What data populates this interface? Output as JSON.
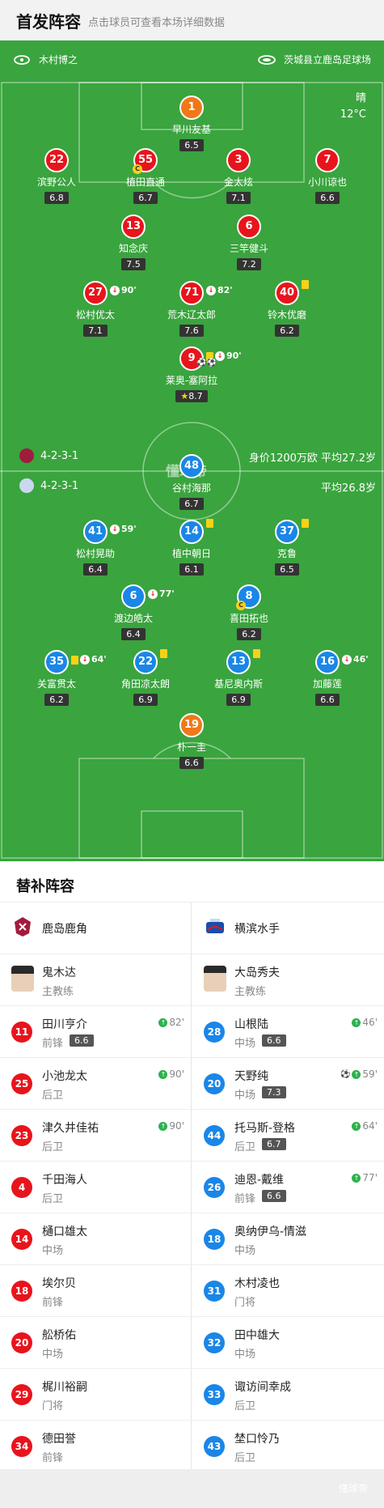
{
  "header": {
    "title": "首发阵容",
    "subtitle": "点击球员可查看本场详细数据"
  },
  "match": {
    "referee": "木村博之",
    "venue": "茨城县立鹿岛足球场",
    "weather": "晴",
    "temperature": "12°C",
    "watermark": "懂球帝"
  },
  "home": {
    "formation": "4-2-3-1",
    "info": "身价1200万欧 平均27.2岁"
  },
  "away": {
    "formation": "4-2-3-1",
    "info": "平均26.8岁"
  },
  "home_players": [
    {
      "num": "1",
      "name": "早川友基",
      "rating": "6.5",
      "color": "orange"
    },
    {
      "num": "22",
      "name": "滨野公人",
      "rating": "6.8",
      "color": "red"
    },
    {
      "num": "55",
      "name": "植田直通",
      "rating": "6.7",
      "color": "red",
      "captain": true
    },
    {
      "num": "3",
      "name": "金太炫",
      "rating": "7.1",
      "color": "red"
    },
    {
      "num": "7",
      "name": "小川谅也",
      "rating": "6.6",
      "color": "red"
    },
    {
      "num": "13",
      "name": "知念庆",
      "rating": "7.5",
      "color": "red"
    },
    {
      "num": "6",
      "name": "三竿健斗",
      "rating": "7.2",
      "color": "red"
    },
    {
      "num": "27",
      "name": "松村优太",
      "rating": "7.1",
      "color": "red",
      "sub": "90'"
    },
    {
      "num": "71",
      "name": "荒木辽太郎",
      "rating": "7.6",
      "color": "red",
      "sub": "82'"
    },
    {
      "num": "40",
      "name": "铃木优磨",
      "rating": "6.2",
      "color": "red",
      "card": true
    },
    {
      "num": "9",
      "name": "莱奥-塞阿拉",
      "rating": "8.7",
      "color": "red",
      "card": true,
      "sub": "90'",
      "goals": "⚽⚽",
      "star": true
    }
  ],
  "away_players": [
    {
      "num": "48",
      "name": "谷村海那",
      "rating": "6.7",
      "color": "blue"
    },
    {
      "num": "41",
      "name": "松村晃助",
      "rating": "6.4",
      "color": "blue",
      "sub": "59'"
    },
    {
      "num": "14",
      "name": "植中朝日",
      "rating": "6.1",
      "color": "blue",
      "card": true
    },
    {
      "num": "37",
      "name": "克鲁",
      "rating": "6.5",
      "color": "blue",
      "card": true
    },
    {
      "num": "6",
      "name": "渡边皓太",
      "rating": "6.4",
      "color": "blue",
      "sub": "77'"
    },
    {
      "num": "8",
      "name": "喜田拓也",
      "rating": "6.2",
      "color": "blue",
      "captain": true
    },
    {
      "num": "35",
      "name": "关富贯太",
      "rating": "6.2",
      "color": "blue",
      "card": true,
      "sub": "64'"
    },
    {
      "num": "22",
      "name": "角田凉太朗",
      "rating": "6.9",
      "color": "blue",
      "card": true
    },
    {
      "num": "13",
      "name": "基尼奥内斯",
      "rating": "6.9",
      "color": "blue",
      "card": true
    },
    {
      "num": "16",
      "name": "加藤莲",
      "rating": "6.6",
      "color": "blue",
      "sub": "46'"
    },
    {
      "num": "19",
      "name": "朴一圭",
      "rating": "6.6",
      "color": "orange"
    }
  ],
  "subs": {
    "title": "替补阵容",
    "left": {
      "team": "鹿岛鹿角",
      "coach": {
        "name": "鬼木达",
        "role": "主教练"
      },
      "players": [
        {
          "num": "11",
          "name": "田川亨介",
          "pos": "前锋",
          "rating": "6.6",
          "in": "82'"
        },
        {
          "num": "25",
          "name": "小池龙太",
          "pos": "后卫",
          "in": "90'"
        },
        {
          "num": "23",
          "name": "津久井佳祐",
          "pos": "后卫",
          "in": "90'"
        },
        {
          "num": "4",
          "name": "千田海人",
          "pos": "后卫"
        },
        {
          "num": "14",
          "name": "樋口雄太",
          "pos": "中场"
        },
        {
          "num": "18",
          "name": "埃尔贝",
          "pos": "前锋"
        },
        {
          "num": "20",
          "name": "舩桥佑",
          "pos": "中场"
        },
        {
          "num": "29",
          "name": "梶川裕嗣",
          "pos": "门将"
        },
        {
          "num": "34",
          "name": "德田誉",
          "pos": "前锋"
        }
      ]
    },
    "right": {
      "team": "横滨水手",
      "coach": {
        "name": "大岛秀夫",
        "role": "主教练"
      },
      "players": [
        {
          "num": "28",
          "name": "山根陆",
          "pos": "中场",
          "rating": "6.6",
          "in": "46'"
        },
        {
          "num": "20",
          "name": "天野纯",
          "pos": "中场",
          "rating": "7.3",
          "in": "59'",
          "goal": "⚽"
        },
        {
          "num": "44",
          "name": "托马斯-登格",
          "pos": "后卫",
          "rating": "6.7",
          "in": "64'"
        },
        {
          "num": "26",
          "name": "迪恩-戴维",
          "pos": "前锋",
          "rating": "6.6",
          "in": "77'"
        },
        {
          "num": "18",
          "name": "奥纳伊乌-情滋",
          "pos": "中场"
        },
        {
          "num": "31",
          "name": "木村凌也",
          "pos": "门将"
        },
        {
          "num": "32",
          "name": "田中雄大",
          "pos": "中场"
        },
        {
          "num": "33",
          "name": "诹访间幸成",
          "pos": "后卫"
        },
        {
          "num": "43",
          "name": "埜口怜乃",
          "pos": "后卫"
        }
      ]
    }
  }
}
